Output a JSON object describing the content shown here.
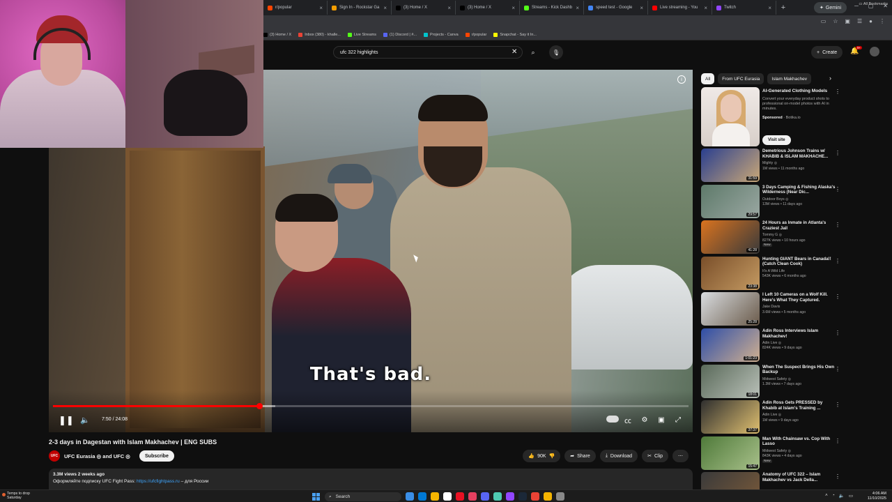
{
  "browser": {
    "tabs": [
      {
        "title": "r/popular",
        "color": "#ff4500"
      },
      {
        "title": "Sign In - Rockstar Ga",
        "color": "#f29d00"
      },
      {
        "title": "(3) Home / X",
        "color": "#000000"
      },
      {
        "title": "(3) Home / X",
        "color": "#000000"
      },
      {
        "title": "Streams - Kick Dashb",
        "color": "#53fc18"
      },
      {
        "title": "speed test - Google",
        "color": "#4285f4"
      },
      {
        "title": "Live streaming - You",
        "color": "#ff0000"
      },
      {
        "title": "Twitch",
        "color": "#9146ff"
      }
    ],
    "new_tab": "+",
    "gemini_label": "Gemini",
    "bookmarks": [
      {
        "label": "(3) Home / X",
        "color": "#000000"
      },
      {
        "label": "Inbox (380) - khalle...",
        "color": "#ea4335"
      },
      {
        "label": "Live Streams",
        "color": "#53fc18"
      },
      {
        "label": "(1) Discord | #...",
        "color": "#5865f2"
      },
      {
        "label": "Projects - Canva",
        "color": "#00c4cc"
      },
      {
        "label": "r/popular",
        "color": "#ff4500"
      },
      {
        "label": "Snapchat - Say it In...",
        "color": "#fffc00"
      }
    ],
    "all_bookmarks": "All Bookmarks"
  },
  "youtube": {
    "search_value": "ufc 322 highlights",
    "create_label": "Create",
    "notif_count": "9+"
  },
  "player": {
    "subtitle": "That's bad.",
    "time": "7:50 / 24:08",
    "progress_fraction": 0.325,
    "buffer_fraction": 0.35,
    "title": "2-3 days in Dagestan with Islam Makhachev | ENG SUBS"
  },
  "channel": {
    "avatar_text": "UFC",
    "name": "UFC Eurasia ◎ and UFC ◎",
    "subscribe": "Subscribe"
  },
  "actions": {
    "likes": "90K",
    "share": "Share",
    "download": "Download",
    "clip": "Clip"
  },
  "description": {
    "meta": "3.3M views  2 weeks ago",
    "text_before": "Оформляйте подписку UFC Fight Pass: ",
    "link": "https://ufcfightpass.ru",
    "text_after": " – для России"
  },
  "sidebar": {
    "chips": [
      "All",
      "From UFC Eurasia",
      "Islam Makhachev"
    ],
    "ad": {
      "title": "AI-Generated Clothing Models",
      "desc": "Convert your everyday product shots to professional on-model photos with AI in minutes.",
      "sponsored": "Sponsored",
      "advertiser": "Botika.io",
      "cta": "Visit site"
    },
    "recs": [
      {
        "title": "Demetrious Johnson Trains w/ KHABIB & ISLAM MAKHACHE...",
        "channel": "Mighty ◎",
        "meta": "1M views • 11 months ago",
        "duration": "31:59",
        "new": "",
        "colors": [
          "#2a3f8f",
          "#c9a777"
        ]
      },
      {
        "title": "3 Days Camping & Fishing Alaska's Wilderness (Near Dic...",
        "channel": "Outdoor Boys ◎",
        "meta": "13M views • 11 days ago",
        "duration": "29:57",
        "new": "",
        "colors": [
          "#5e7a6a",
          "#9aa7a2"
        ]
      },
      {
        "title": "24 Hours as Inmate in Atlanta's Craziest Jail",
        "channel": "Tommy G ◎",
        "meta": "827K views • 10 hours ago",
        "duration": "41:28",
        "new": "New",
        "colors": [
          "#d9731f",
          "#3a3a3a"
        ]
      },
      {
        "title": "Hunting GIANT Bears in Canada!! (Catch Clean Cook)",
        "channel": "It's A Wild Life",
        "meta": "543K views • 6 months ago",
        "duration": "23:38",
        "new": "",
        "colors": [
          "#7a4f2a",
          "#c49a62"
        ]
      },
      {
        "title": "I Left 10 Cameras on a Wolf Kill. Here's What They Captured.",
        "channel": "Jake Davis",
        "meta": "3.6M views • 5 months ago",
        "duration": "25:28",
        "new": "",
        "colors": [
          "#d9dde0",
          "#6a5a4a"
        ]
      },
      {
        "title": "Adin Ross Interviews Islam Makhachev!",
        "channel": "Adin Live ◎",
        "meta": "824K views • 9 days ago",
        "duration": "1:01:23",
        "new": "",
        "colors": [
          "#2e4ea8",
          "#d0b090"
        ]
      },
      {
        "title": "When The Suspect Brings His Own Backup",
        "channel": "Midwest Safety ◎",
        "meta": "1.3M views • 7 days ago",
        "duration": "18:01",
        "new": "",
        "colors": [
          "#5a6a5a",
          "#b9c0b8"
        ]
      },
      {
        "title": "Adin Ross Gets PRESSED by Khabib at Islam's Training ...",
        "channel": "Adin Live ◎",
        "meta": "1M views • 9 days ago",
        "duration": "37:37",
        "new": "",
        "colors": [
          "#2f2f2f",
          "#e0c070"
        ]
      },
      {
        "title": "Man With Chainsaw vs. Cop With Lasso",
        "channel": "Midwest Safety ◎",
        "meta": "843K views • 4 days ago",
        "duration": "15:47",
        "new": "New",
        "colors": [
          "#4f7a3a",
          "#a8c08a"
        ]
      },
      {
        "title": "Anatomy of UFC 322 – Islam Makhachev vs Jack Della...",
        "channel": "",
        "meta": "",
        "duration": "",
        "new": "",
        "colors": [
          "#3a3a3a",
          "#7a5a3a"
        ]
      }
    ]
  },
  "taskbar": {
    "weather_line1": "Temps to drop",
    "weather_line2": "Saturday",
    "search": "Search",
    "time": "4:06 AM",
    "date": "11/10/2025",
    "app_colors": [
      "#3a8ee6",
      "#0078d4",
      "#f4b400",
      "#ffffff",
      "#e81123",
      "#e4405f",
      "#5865f2",
      "#4ec9b0",
      "#9146ff",
      "#1b2838",
      "#ea4335",
      "#f4b400",
      "#888888"
    ]
  }
}
